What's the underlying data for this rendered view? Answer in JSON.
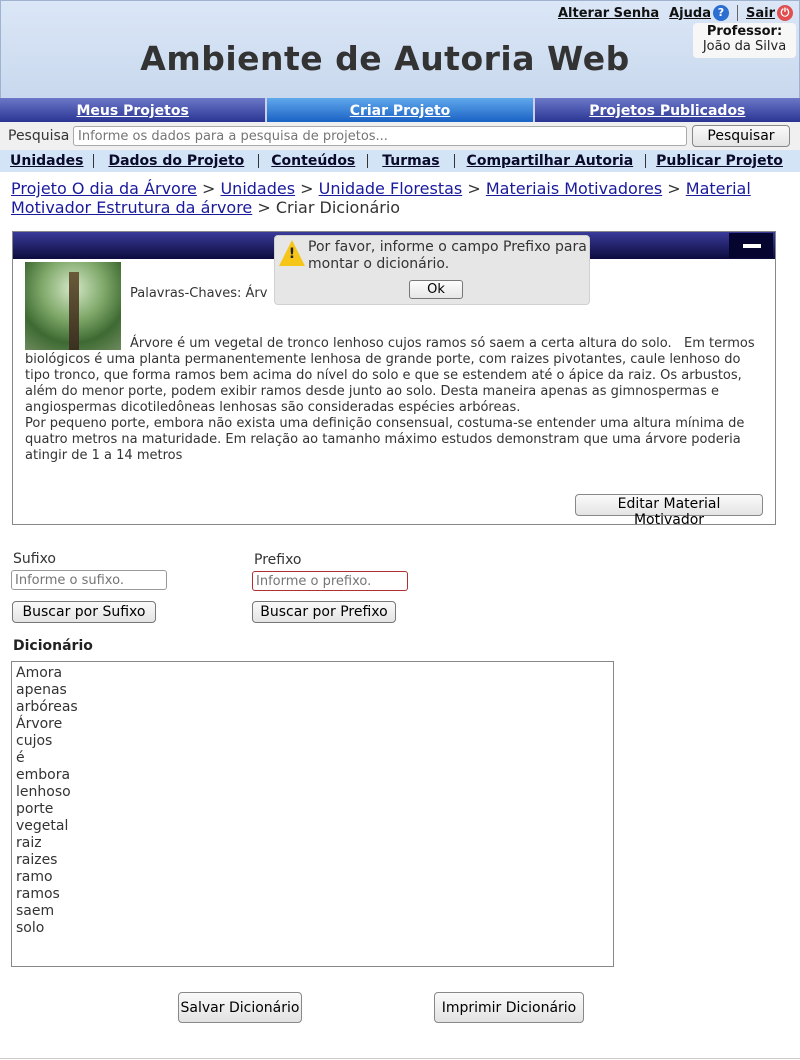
{
  "header": {
    "title": "Ambiente de Autoria Web",
    "links": {
      "change_password": "Alterar Senha",
      "help": "Ajuda",
      "logout": "Sair"
    },
    "user_role": "Professor:",
    "user_name": "João da Silva"
  },
  "nav": {
    "tabs": [
      {
        "label": "Meus Projetos"
      },
      {
        "label": "Criar Projeto"
      },
      {
        "label": "Projetos Publicados"
      }
    ],
    "active_tab": "Criar Projeto"
  },
  "search": {
    "label": "Pesquisa",
    "placeholder": "Informe os dados para a pesquisa de projetos...",
    "button": "Pesquisar"
  },
  "submenu": [
    {
      "label": "Unidades"
    },
    {
      "label": "Dados do Projeto"
    },
    {
      "label": "Conteúdos"
    },
    {
      "label": "Turmas"
    },
    {
      "label": "Compartilhar Autoria"
    },
    {
      "label": "Publicar Projeto"
    }
  ],
  "breadcrumb": {
    "items": [
      "Projeto O dia da Árvore",
      "Unidades",
      "Unidade Florestas",
      "Materiais Motivadores",
      "Material Motivador Estrutura da árvore"
    ],
    "current": "Criar Dicionário"
  },
  "material": {
    "keywords_label": "Palavras-Chaves: Árv",
    "text": "Árvore é um vegetal de tronco lenhoso cujos ramos só saem a certa altura do solo.   Em termos biológicos é uma planta permanentemente lenhosa de grande porte, com raizes pivotantes, caule lenhoso do tipo tronco, que forma ramos bem acima do nível do solo e que se estendem até o ápice da raiz. Os arbustos, além do menor porte, podem exibir ramos desde junto ao solo. Desta maneira apenas as gimnospermas e angiospermas dicotiledôneas lenhosas são consideradas espécies arbóreas.\nPor pequeno porte, embora não exista uma definição consensual, costuma-se entender uma altura mínima de quatro metros na maturidade. Em relação ao tamanho máximo estudos demonstram que uma árvore poderia atingir de 1 a 14 metros",
    "edit_button": "Editar Material Motivador"
  },
  "alert": {
    "icon": "warning-icon",
    "message": "Por favor, informe o campo Prefixo para montar o dicionário.",
    "ok_button": "Ok"
  },
  "affix": {
    "suffix_label": "Sufixo",
    "suffix_placeholder": "Informe o sufixo.",
    "suffix_button": "Buscar por Sufixo",
    "prefix_label": "Prefixo",
    "prefix_placeholder": "Informe o prefixo.",
    "prefix_button": "Buscar por Prefixo"
  },
  "dictionary": {
    "title": "Dicionário",
    "words": [
      "Amora",
      "apenas",
      "arbóreas",
      "Árvore",
      "cujos",
      "é",
      "embora",
      "lenhoso",
      "porte",
      "vegetal",
      "raiz",
      "raizes",
      "ramo",
      "ramos",
      "saem",
      "solo"
    ]
  },
  "actions": {
    "save": "Salvar Dicionário",
    "print": "Imprimir Dicionário"
  },
  "colors": {
    "nav_dark": "#2a3593",
    "nav_active": "#1a62c4",
    "link": "#1a1a9c",
    "panel_header": "#0c0c3e",
    "warning": "#f5c518"
  }
}
